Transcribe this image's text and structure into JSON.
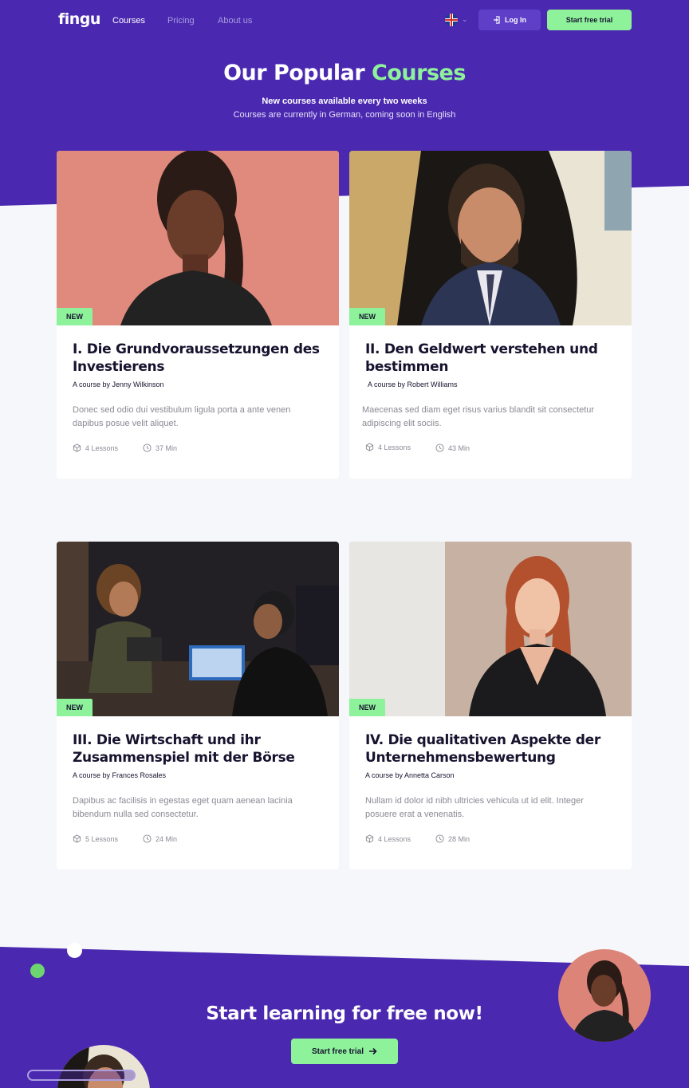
{
  "nav": {
    "logo": "fingu",
    "links": [
      "Courses",
      "Pricing",
      "About us"
    ],
    "login_label": "Log In",
    "trial_label": "Start free trial",
    "language_icon": "uk-flag-icon"
  },
  "hero": {
    "title_main": "Our Popular ",
    "title_accent": "Courses",
    "subtitle_bold": "New courses available every two weeks",
    "subtitle": "Courses are currently in German, coming soon in English"
  },
  "courses": [
    {
      "badge": "NEW",
      "title": "I. Die Grundvoraussetzungen des Investierens",
      "author": "A course by Jenny Wilkinson",
      "description": "Donec sed odio dui vestibulum ligula porta a ante venen dapibus posue velit aliquet.",
      "lessons": "4 Lessons",
      "duration": "37 Min"
    },
    {
      "badge": "NEW",
      "title": "II. Den Geldwert verstehen und bestimmen",
      "author": "A course by Robert Williams",
      "description": "Maecenas sed diam eget risus varius blandit sit consectetur adipiscing elit sociis.",
      "lessons": "4 Lessons",
      "duration": "43 Min"
    },
    {
      "badge": "NEW",
      "title": "III. Die Wirtschaft und ihr Zusammenspiel mit der Börse",
      "author": "A course by Frances Rosales",
      "description": "Dapibus ac facilisis in egestas eget quam aenean lacinia bibendum nulla sed consectetur.",
      "lessons": "5 Lessons",
      "duration": "24 Min"
    },
    {
      "badge": "NEW",
      "title": "IV. Die qualitativen Aspekte der Unternehmensbewertung",
      "author": "A course by Annetta Carson",
      "description": "Nullam id dolor id nibh ultricies vehicula ut id elit. Integer posuere erat a venenatis.",
      "lessons": "4 Lessons",
      "duration": "28 Min"
    }
  ],
  "cta": {
    "title": "Start learning for free now!",
    "button_label": "Start free trial"
  },
  "colors": {
    "brand_purple": "#4a28b0",
    "accent_green": "#8ef29b",
    "text_dark": "#17122e"
  }
}
